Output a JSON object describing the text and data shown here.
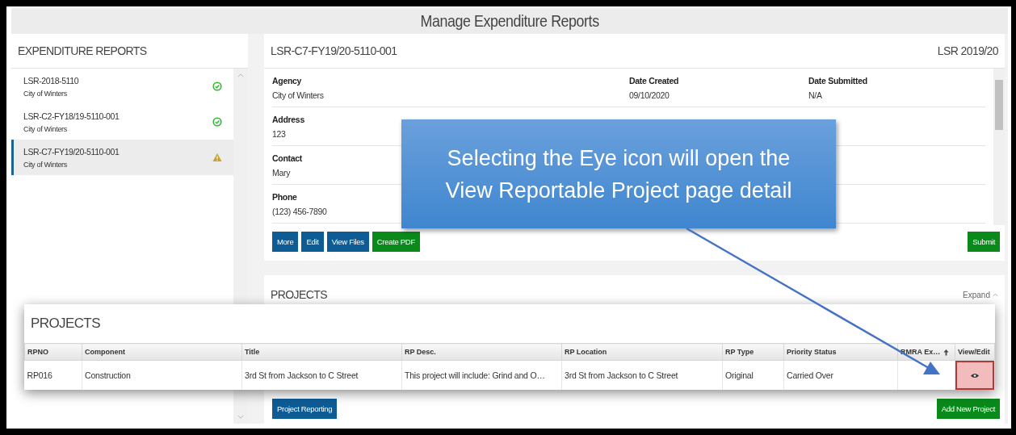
{
  "page_title": "Manage Expenditure Reports",
  "reports_panel": {
    "title": "EXPENDITURE REPORTS",
    "items": [
      {
        "name": "LSR-2018-5110",
        "agency": "City of Winters",
        "kind": "ok",
        "selected": false
      },
      {
        "name": "LSR-C2-FY18/19-5110-001",
        "agency": "City of Winters",
        "kind": "ok",
        "selected": false
      },
      {
        "name": "LSR-C7-FY19/20-5110-001",
        "agency": "City of Winters",
        "kind": "warning",
        "selected": true
      }
    ]
  },
  "detail": {
    "report_id": "LSR-C7-FY19/20-5110-001",
    "fiscal_label": "LSR 2019/20",
    "rows": [
      [
        {
          "label": "Agency",
          "value": "City of Winters"
        },
        {
          "label": "Date Created",
          "value": "09/10/2020"
        },
        {
          "label": "Date Submitted",
          "value": "N/A"
        }
      ],
      [
        {
          "label": "Address",
          "value": "123"
        }
      ],
      [
        {
          "label": "Contact",
          "value": "Mary"
        }
      ],
      [
        {
          "label": "Phone",
          "value": "(123) 456-7890"
        }
      ]
    ],
    "buttons": [
      {
        "label": "More",
        "kind": "primary"
      },
      {
        "label": "Edit",
        "kind": "primary"
      },
      {
        "label": "View Files",
        "kind": "primary"
      },
      {
        "label": "Create PDF",
        "kind": "success"
      }
    ],
    "submit": "Submit"
  },
  "projects": {
    "title": "PROJECTS",
    "expand": "Expand",
    "report_button": "Project Reporting",
    "add_button": "Add New Project"
  },
  "projects_zoom": {
    "title": "PROJECTS",
    "columns": [
      {
        "label": "RPNO"
      },
      {
        "label": "Component"
      },
      {
        "label": "Title"
      },
      {
        "label": "RP Desc."
      },
      {
        "label": "RP Location"
      },
      {
        "label": "RP Type"
      },
      {
        "label": "Priority Status"
      },
      {
        "label": "RMRA Ex…",
        "sorted": true
      },
      {
        "label": "View/Edit"
      }
    ],
    "rows": [
      {
        "cells": [
          "RP016",
          "Construction",
          "3rd St from Jackson to C Street",
          "This project will include: Grind and O…",
          "3rd St from Jackson to C Street",
          "Original",
          "Carried Over",
          ""
        ],
        "highlighted": true
      }
    ]
  },
  "callout": {
    "text": "Selecting the Eye icon will open the View Reportable Project page detail"
  }
}
